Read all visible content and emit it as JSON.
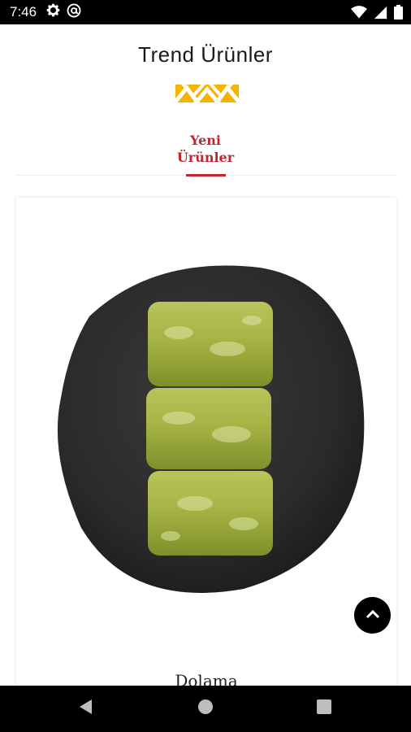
{
  "status_bar": {
    "time": "7:46",
    "left_icons": [
      "gear-icon",
      "at-sign-icon"
    ],
    "right_icons": [
      "wifi-icon",
      "signal-icon",
      "battery-icon"
    ]
  },
  "header": {
    "title": "Trend Ürünler",
    "ornament_colors": [
      "#f5b400",
      "#e8a100"
    ]
  },
  "tabs": [
    {
      "label": "Yeni Ürünler",
      "selected": true,
      "accent": "#c0272d"
    }
  ],
  "products": [
    {
      "name": "Dolama",
      "image": "pistachio-baklava-rolls-on-black-plate"
    }
  ],
  "controls": {
    "scroll_top_icon": "chevron-up-icon"
  },
  "nav_bar": {
    "buttons": [
      "back-icon",
      "home-icon",
      "recents-icon"
    ]
  }
}
